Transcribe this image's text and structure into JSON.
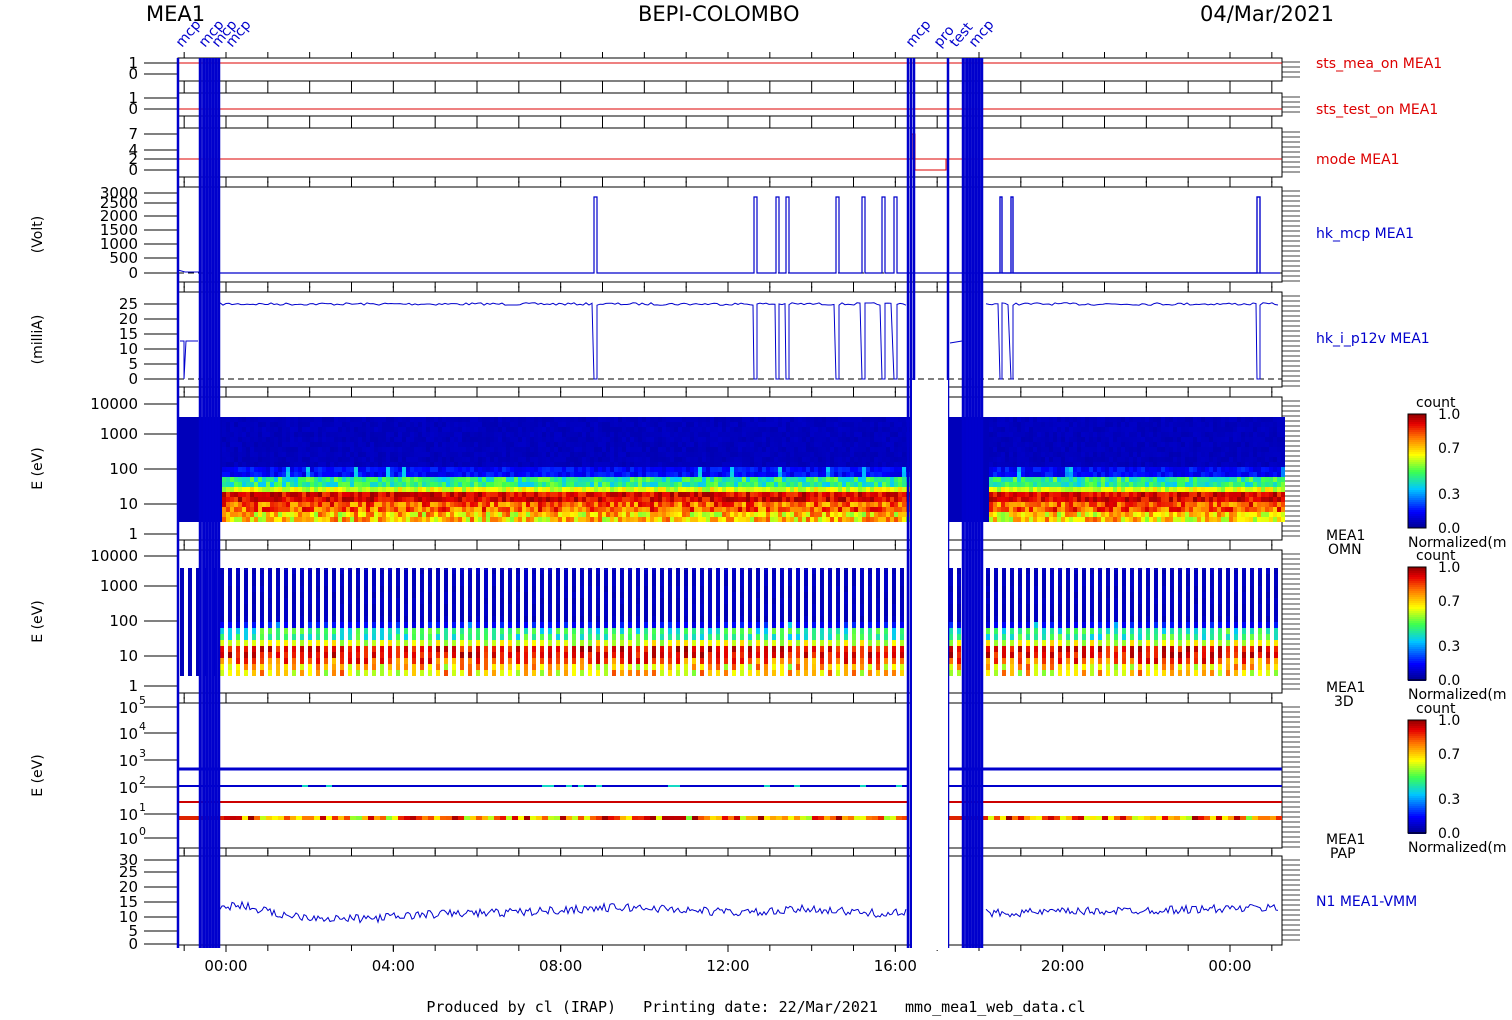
{
  "header": {
    "left": "MEA1",
    "center": "BEPI-COLOMBO",
    "right": "04/Mar/2021"
  },
  "footer": "Produced by cl (IRAP)   Printing date: 22/Mar/2021   mmo_mea1_web_data.cl",
  "event_markers": {
    "left_labels": [
      "mcp",
      "mcp",
      "mcp",
      "mcp"
    ],
    "right_labels": [
      "mcp",
      "pro",
      "test",
      "mcp"
    ]
  },
  "colorbar": {
    "title": "count",
    "ticks": [
      "1.0",
      "0.7",
      "0.3",
      "0.0"
    ],
    "label": "Normalized(m"
  },
  "colors": {
    "house_red": "#dd0000",
    "data_blue": "#0000cc",
    "axis": "#000000"
  },
  "chart_data": [
    {
      "type": "line",
      "name": "sts_mea_on MEA1",
      "yticks": [
        "1",
        "0"
      ],
      "value_level": 1,
      "series_color": "#dd0000"
    },
    {
      "type": "line",
      "name": "sts_test_on MEA1",
      "yticks": [
        "1",
        "0"
      ],
      "value_level": 0,
      "series_color": "#dd0000"
    },
    {
      "type": "line",
      "name": "mode MEA1",
      "yticks": [
        "7",
        "4",
        "2",
        "0"
      ],
      "value_level": 2,
      "series_color": "#dd0000"
    },
    {
      "type": "line",
      "name": "hk_mcp MEA1",
      "ylabel": "(Volt)",
      "yticks": [
        "3000",
        "2500",
        "2000",
        "1500",
        "1000",
        "500",
        "0"
      ],
      "ylim": [
        0,
        3000
      ],
      "series_color": "#0000cc",
      "description_values": {
        "baseline": 0,
        "pulse_peak": 2800
      }
    },
    {
      "type": "line",
      "name": "hk_i_p12v MEA1",
      "ylabel": "(milliA)",
      "yticks": [
        "25",
        "20",
        "15",
        "10",
        "5",
        "0"
      ],
      "ylim": [
        0,
        27
      ],
      "series_color": "#0000cc",
      "description_values": {
        "operating_level": 25,
        "off_level": 0
      }
    },
    {
      "type": "heatmap",
      "name": "MEA1 OMN",
      "ylabel": "E (eV)",
      "yticks": [
        "10000",
        "1000",
        "100",
        "10",
        "1"
      ],
      "ylim": [
        1,
        10000
      ],
      "scale": "log"
    },
    {
      "type": "heatmap",
      "name": "MEA1 3D",
      "ylabel": "E (eV)",
      "yticks": [
        "10000",
        "1000",
        "100",
        "10",
        "1"
      ],
      "ylim": [
        1,
        10000
      ],
      "scale": "log"
    },
    {
      "type": "heatmap",
      "name": "MEA1 PAP",
      "ylabel": "E (eV)",
      "yticks": [
        "10^5",
        "10^4",
        "10^3",
        "10^2",
        "10^1",
        "10^0"
      ],
      "ylim": [
        1,
        100000
      ],
      "scale": "log"
    },
    {
      "type": "line",
      "name": "N1 MEA1-VMM",
      "yticks": [
        "30",
        "25",
        "20",
        "15",
        "10",
        "5",
        "0"
      ],
      "ylim": [
        0,
        30
      ],
      "series_color": "#0000cc",
      "description_values": {
        "mean_level": 11
      }
    }
  ],
  "xaxis": {
    "ticks": [
      "00:00",
      "04:00",
      "08:00",
      "12:00",
      "16:00",
      "20:00",
      "00:00"
    ]
  }
}
